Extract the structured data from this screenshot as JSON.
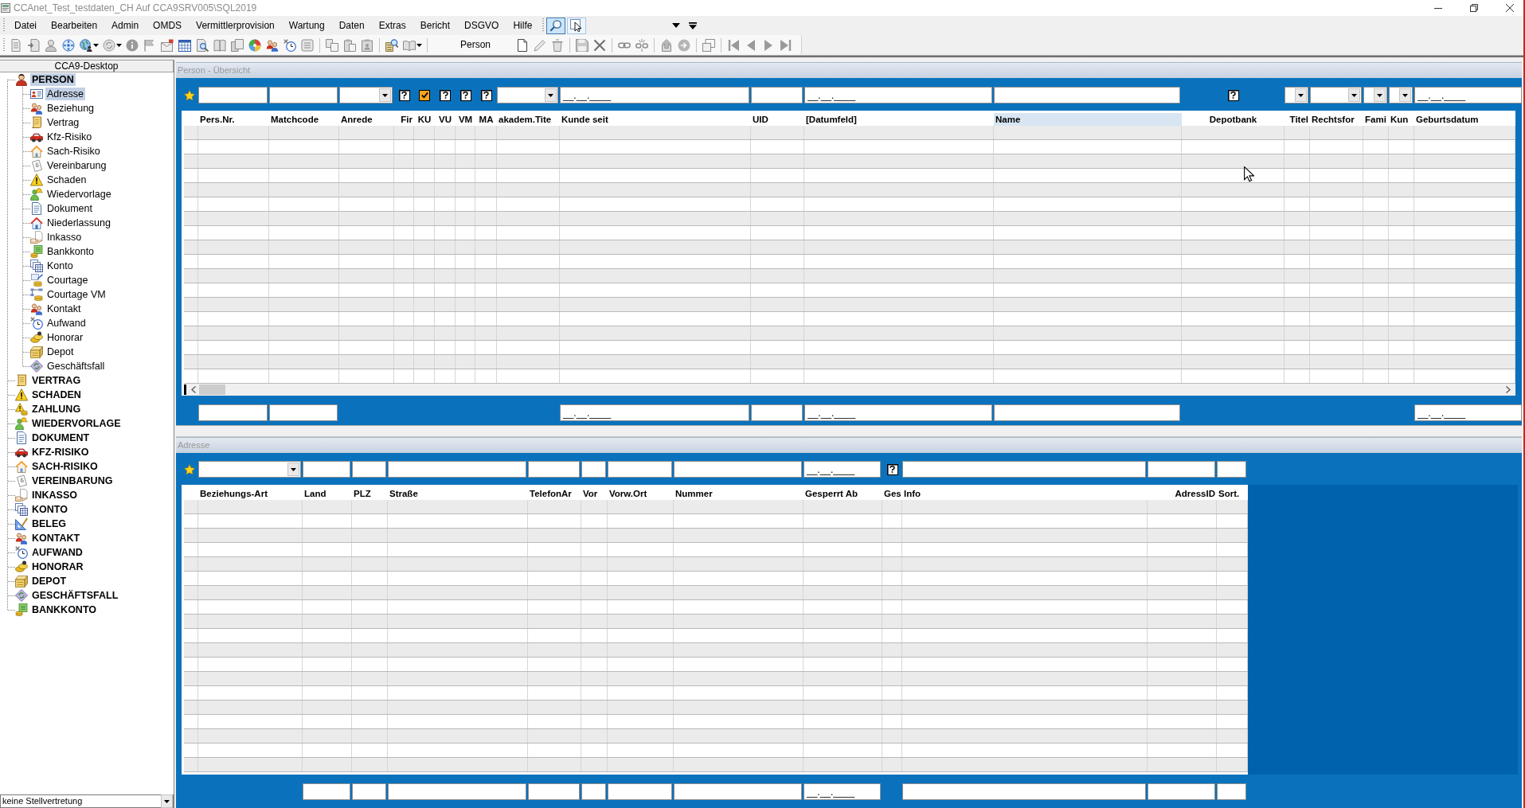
{
  "window": {
    "title": "CCAnet_Test_testdaten_CH Auf CCA9SRV005\\SQL2019"
  },
  "menu": [
    "Datei",
    "Bearbeiten",
    "Admin",
    "OMDS",
    "Vermittlerprovision",
    "Wartung",
    "Daten",
    "Extras",
    "Bericht",
    "DSGVO",
    "Hilfe"
  ],
  "menu_tools": [
    {
      "selected": true
    },
    {
      "selected": false
    }
  ],
  "toolbar": {
    "label": "Person"
  },
  "sidebar": {
    "title": "CCA9-Desktop",
    "tree": [
      {
        "label": "PERSON",
        "selected": true,
        "children": [
          {
            "label": "Adresse",
            "selected": true
          },
          {
            "label": "Beziehung",
            "selected": false
          },
          {
            "label": "Vertrag",
            "selected": false
          },
          {
            "label": "Kfz-Risiko",
            "selected": false
          },
          {
            "label": "Sach-Risiko",
            "selected": false
          },
          {
            "label": "Vereinbarung",
            "selected": false
          },
          {
            "label": "Schaden",
            "selected": false
          },
          {
            "label": "Wiedervorlage",
            "selected": false
          },
          {
            "label": "Dokument",
            "selected": false
          },
          {
            "label": "Niederlassung",
            "selected": false
          },
          {
            "label": "Inkasso",
            "selected": false
          },
          {
            "label": "Bankkonto",
            "selected": false
          },
          {
            "label": "Konto",
            "selected": false
          },
          {
            "label": "Courtage",
            "selected": false
          },
          {
            "label": "Courtage VM",
            "selected": false
          },
          {
            "label": "Kontakt",
            "selected": false
          },
          {
            "label": "Aufwand",
            "selected": false
          },
          {
            "label": "Honorar",
            "selected": false
          },
          {
            "label": "Depot",
            "selected": false
          },
          {
            "label": "Geschäftsfall",
            "selected": false
          }
        ]
      },
      {
        "label": "VERTRAG",
        "selected": false
      },
      {
        "label": "SCHADEN",
        "selected": false
      },
      {
        "label": "ZAHLUNG",
        "selected": false
      },
      {
        "label": "WIEDERVORLAGE",
        "selected": false
      },
      {
        "label": "DOKUMENT",
        "selected": false
      },
      {
        "label": "KFZ-RISIKO",
        "selected": false
      },
      {
        "label": "SACH-RISIKO",
        "selected": false
      },
      {
        "label": "VEREINBARUNG",
        "selected": false
      },
      {
        "label": "INKASSO",
        "selected": false
      },
      {
        "label": "KONTO",
        "selected": false
      },
      {
        "label": "BELEG",
        "selected": false
      },
      {
        "label": "KONTAKT",
        "selected": false
      },
      {
        "label": "AUFWAND",
        "selected": false
      },
      {
        "label": "HONORAR",
        "selected": false
      },
      {
        "label": "DEPOT",
        "selected": false
      },
      {
        "label": "GESCHÄFTSFALL",
        "selected": false
      },
      {
        "label": "BANKKONTO",
        "selected": false
      }
    ],
    "substitute": {
      "value": "keine Stellvertretung"
    }
  },
  "panels": [
    {
      "title": "Person - Übersicht",
      "columns": [
        {
          "label": "Pers.Nr.",
          "selected": false,
          "filter": {
            "kind": "text"
          },
          "footer": {
            "kind": "text"
          }
        },
        {
          "label": "Matchcode",
          "selected": false,
          "filter": {
            "kind": "text"
          },
          "footer": {
            "kind": "text"
          }
        },
        {
          "label": "Anrede",
          "selected": false,
          "filter": {
            "kind": "combo"
          }
        },
        {
          "label": "Fir",
          "selected": false,
          "filter": {
            "kind": "check",
            "indeterminate": true
          }
        },
        {
          "label": "KU",
          "selected": false,
          "filter": {
            "kind": "check",
            "checked": true
          }
        },
        {
          "label": "VU",
          "selected": false,
          "filter": {
            "kind": "check",
            "indeterminate": true
          }
        },
        {
          "label": "VM",
          "selected": false,
          "filter": {
            "kind": "check",
            "indeterminate": true
          }
        },
        {
          "label": "MA",
          "selected": false,
          "filter": {
            "kind": "check",
            "indeterminate": true
          }
        },
        {
          "label": "akadem.Tite",
          "selected": false,
          "filter": {
            "kind": "combo"
          }
        },
        {
          "label": "Kunde seit",
          "selected": false,
          "filter": {
            "kind": "date",
            "placeholder": "__.__.____"
          },
          "footer": {
            "kind": "date",
            "placeholder": "__.__.____"
          }
        },
        {
          "label": "UID",
          "selected": false,
          "filter": {
            "kind": "text"
          },
          "footer": {
            "kind": "text"
          }
        },
        {
          "label": "[Datumfeld]",
          "selected": false,
          "filter": {
            "kind": "date",
            "placeholder": "__.__.____"
          },
          "footer": {
            "kind": "date",
            "placeholder": "__.__.____"
          }
        },
        {
          "label": "Name",
          "selected": true,
          "filter": {
            "kind": "text"
          },
          "footer": {
            "kind": "text"
          }
        },
        {
          "label": "Depotbank",
          "selected": false,
          "filter": {
            "kind": "check",
            "indeterminate": true
          }
        },
        {
          "label": "Titel",
          "selected": false,
          "filter": {
            "kind": "combo"
          }
        },
        {
          "label": "Rechtsfor",
          "selected": false,
          "filter": {
            "kind": "combo"
          }
        },
        {
          "label": "Fami",
          "selected": false,
          "filter": {
            "kind": "combo"
          }
        },
        {
          "label": "Kun",
          "selected": false,
          "filter": {
            "kind": "combo"
          }
        },
        {
          "label": "Geburtsdatum",
          "selected": false,
          "filter": {
            "kind": "date",
            "placeholder": "__.__.____"
          },
          "footer": {
            "kind": "date",
            "placeholder": "__.__.____"
          }
        }
      ]
    },
    {
      "title": "Adresse",
      "columns": [
        {
          "label": "Beziehungs-Art",
          "selected": false,
          "filter": {
            "kind": "combo"
          }
        },
        {
          "label": "Land",
          "selected": false,
          "filter": {
            "kind": "text"
          },
          "footer": {
            "kind": "text"
          }
        },
        {
          "label": "PLZ",
          "selected": false,
          "filter": {
            "kind": "text"
          },
          "footer": {
            "kind": "text"
          }
        },
        {
          "label": "Straße",
          "selected": false,
          "filter": {
            "kind": "text"
          },
          "footer": {
            "kind": "text"
          }
        },
        {
          "label": "TelefonAr",
          "selected": false,
          "filter": {
            "kind": "text"
          },
          "footer": {
            "kind": "text"
          }
        },
        {
          "label": "Vor",
          "selected": false,
          "filter": {
            "kind": "text"
          },
          "footer": {
            "kind": "text"
          }
        },
        {
          "label": "Vorw.Ort",
          "selected": false,
          "filter": {
            "kind": "text"
          },
          "footer": {
            "kind": "text"
          }
        },
        {
          "label": "Nummer",
          "selected": false,
          "filter": {
            "kind": "text"
          },
          "footer": {
            "kind": "text"
          }
        },
        {
          "label": "Gesperrt Ab",
          "selected": false,
          "filter": {
            "kind": "date",
            "placeholder": "__.__.____"
          },
          "footer": {
            "kind": "date",
            "placeholder": "__.__.____"
          }
        },
        {
          "label": "Ges",
          "selected": false,
          "filter": {
            "kind": "check",
            "indeterminate": true
          }
        },
        {
          "label": "Info",
          "selected": false,
          "filter": {
            "kind": "text"
          },
          "footer": {
            "kind": "text"
          }
        },
        {
          "label": "AdressID",
          "selected": false,
          "filter": {
            "kind": "text"
          },
          "footer": {
            "kind": "text"
          }
        },
        {
          "label": "Sort.",
          "selected": false,
          "filter": {
            "kind": "text"
          },
          "footer": {
            "kind": "text"
          }
        }
      ]
    }
  ]
}
